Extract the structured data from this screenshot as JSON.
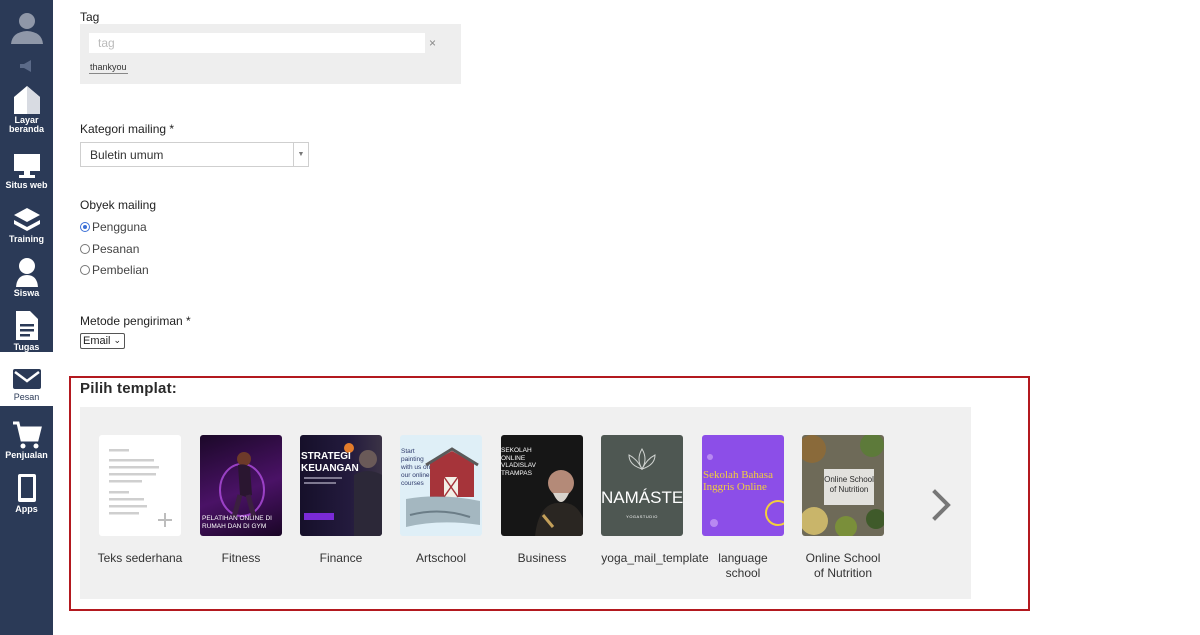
{
  "sidebar": {
    "items": [
      {
        "label": "Layar beranda",
        "icon": "home-icon"
      },
      {
        "label": "Situs web",
        "icon": "monitor-icon"
      },
      {
        "label": "Training",
        "icon": "layers-icon"
      },
      {
        "label": "Siswa",
        "icon": "user-icon"
      },
      {
        "label": "Tugas",
        "icon": "document-icon"
      },
      {
        "label": "Pesan",
        "icon": "envelope-icon"
      },
      {
        "label": "Penjualan",
        "icon": "cart-icon"
      },
      {
        "label": "Apps",
        "icon": "phone-icon"
      }
    ]
  },
  "form": {
    "tag": {
      "label": "Tag",
      "placeholder": "tag",
      "clear": "×",
      "chip": "thankyou"
    },
    "mailing_category": {
      "label": "Kategori mailing *",
      "value": "Buletin umum"
    },
    "mailing_object": {
      "label": "Obyek mailing",
      "options": [
        "Pengguna",
        "Pesanan",
        "Pembelian"
      ],
      "selected": "Pengguna"
    },
    "delivery_method": {
      "label": "Metode pengiriman *",
      "value": "Email"
    }
  },
  "templates": {
    "title": "Pilih templat:",
    "items": [
      {
        "name": "Teks sederhana"
      },
      {
        "name": "Fitness",
        "thumb_text": "PELATIHAN ONLINE DI RUMAH DAN DI GYM"
      },
      {
        "name": "Finance",
        "thumb_text": "STRATEGI KEUANGAN"
      },
      {
        "name": "Artschool",
        "thumb_text": "Start painting with us on our online courses"
      },
      {
        "name": "Business",
        "thumb_text": "SEKOLAH ONLINE VLADISLAV TRAMPAS"
      },
      {
        "name": "yoga_mail_template",
        "thumb_text": "NAMÁSTE",
        "thumb_sub": "YOGASTUDIO"
      },
      {
        "name": "language school",
        "name_lines": [
          "language",
          "school"
        ],
        "thumb_text": "Sekolah Bahasa Inggris Online"
      },
      {
        "name": "Online School of Nutrition",
        "name_lines": [
          "Online School",
          "of Nutrition"
        ],
        "thumb_text": "Online School of Nutrition"
      }
    ]
  },
  "colors": {
    "sidebar": "#2b3a57",
    "highlight_border": "#b3191f",
    "panel": "#f0f0f0",
    "radio_accent": "#3b6fd6"
  }
}
